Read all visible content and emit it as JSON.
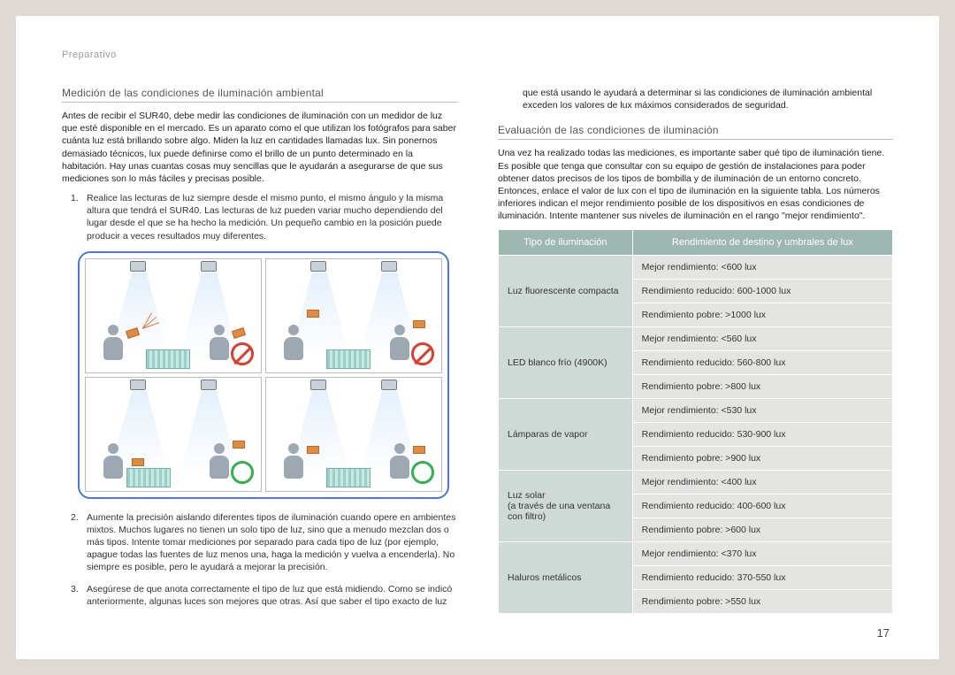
{
  "header": {
    "section": "Preparativo"
  },
  "pageNumber": "17",
  "left": {
    "heading": "Medición de las condiciones de iluminación ambiental",
    "intro": "Antes de recibir el SUR40, debe medir las condiciones de iluminación con un medidor de luz que esté disponible en el mercado. Es un aparato como el que utilizan los fotógrafos para saber cuánta luz está brillando sobre algo. Miden la luz en cantidades llamadas lux. Sin ponernos demasiado técnicos, lux puede definirse como el brillo de un punto determinado en la habitación. Hay unas cuantas cosas muy sencillas que le ayudarán a asegurarse de que sus mediciones son lo más fáciles y precisas posible.",
    "items": [
      {
        "n": "1.",
        "text": "Realice las lecturas de luz siempre desde el mismo punto, el mismo ángulo y la misma altura que tendrá el SUR40. Las lecturas de luz pueden variar mucho dependiendo del lugar desde el que se ha hecho la medición. Un pequeño cambio en la posición puede producir a veces resultados muy diferentes."
      },
      {
        "n": "2.",
        "text": "Aumente la precisión aislando diferentes tipos de iluminación cuando opere en ambientes mixtos. Muchos lugares no tienen un solo tipo de luz, sino que a menudo mezclan dos o más tipos. Intente tomar mediciones por separado para cada tipo de luz (por ejemplo, apague todas las fuentes de luz menos una, haga la medición y vuelva a encenderla). No siempre es posible, pero le ayudará a mejorar la precisión."
      },
      {
        "n": "3.",
        "text": "Asegúrese de que anota correctamente el tipo de luz que está midiendo. Como se indicó anteriormente, algunas luces son mejores que otras. Así que saber el tipo exacto de luz"
      }
    ]
  },
  "right": {
    "topPara": "que está usando le ayudará a determinar si las condiciones de iluminación ambiental exceden los valores de lux máximos considerados de seguridad.",
    "heading": "Evaluación de las condiciones de iluminación",
    "intro": "Una vez ha realizado todas las mediciones, es importante saber qué tipo de iluminación tiene. Es posible que tenga que consultar con su equipo de gestión de instalaciones para poder obtener datos precisos de los tipos de bombilla y de iluminación de un entorno concreto. Entonces, enlace el valor de lux con el tipo de iluminación en la siguiente tabla. Los números inferiores indican el mejor rendimiento posible de los dispositivos en esas condiciones de iluminación. Intente mantener sus niveles de iluminación en el rango \"mejor rendimiento\".",
    "table": {
      "headers": [
        "Tipo de iluminación",
        "Rendimiento de destino y umbrales de lux"
      ],
      "rows": [
        {
          "type": "Luz fluorescente compacta",
          "vals": [
            "Mejor rendimiento: <600 lux",
            "Rendimiento reducido: 600-1000 lux",
            "Rendimiento pobre: >1000 lux"
          ]
        },
        {
          "type": "LED blanco frío (4900K)",
          "vals": [
            "Mejor rendimiento: <560 lux",
            "Rendimiento reducido: 560-800 lux",
            "Rendimiento pobre: >800 lux"
          ]
        },
        {
          "type": "Lámparas de vapor",
          "vals": [
            "Mejor rendimiento: <530 lux",
            "Rendimiento reducido: 530-900 lux",
            "Rendimiento pobre: >900 lux"
          ]
        },
        {
          "type": "Luz solar\n(a través de una ventana con filtro)",
          "vals": [
            "Mejor rendimiento: <400 lux",
            "Rendimiento reducido: 400-600 lux",
            "Rendimiento pobre: >600 lux"
          ]
        },
        {
          "type": "Haluros metálicos",
          "vals": [
            "Mejor rendimiento: <370 lux",
            "Rendimiento reducido: 370-550 lux",
            "Rendimiento pobre: >550 lux"
          ]
        }
      ]
    }
  }
}
